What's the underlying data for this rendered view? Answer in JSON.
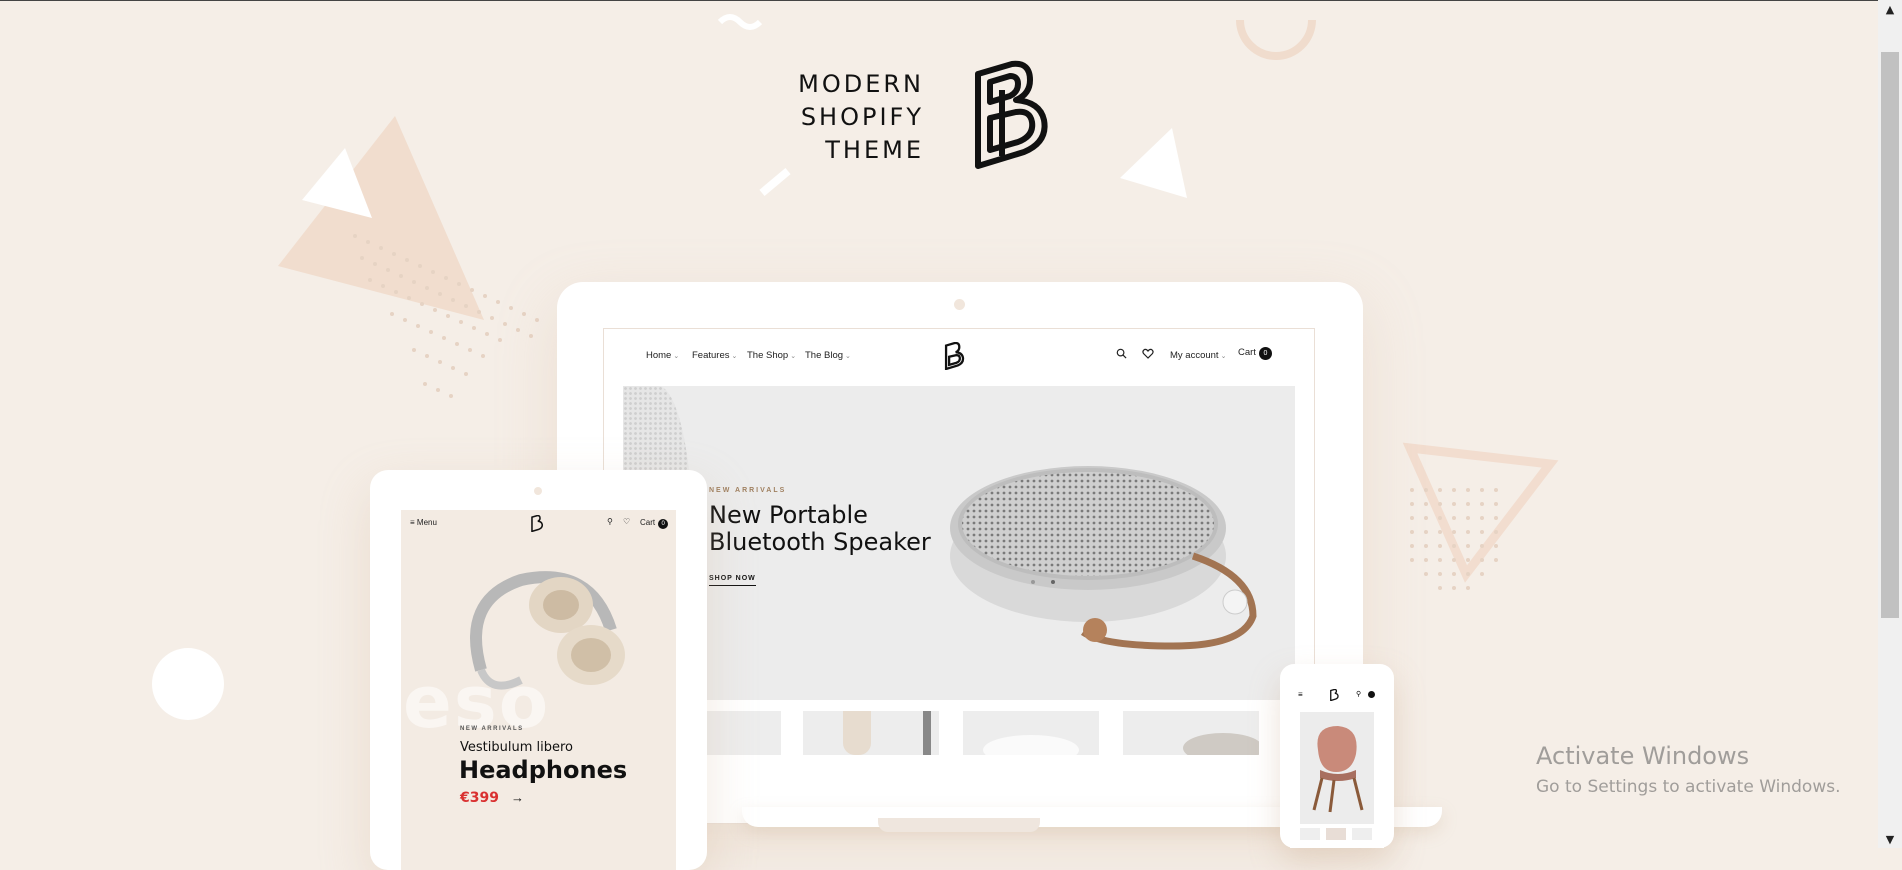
{
  "brand": {
    "line1": "MODERN",
    "line2": "SHOPIFY",
    "line3": "THEME",
    "logo_icon": "b-monogram-logo"
  },
  "laptop_site": {
    "nav": [
      {
        "label": "Home"
      },
      {
        "label": "Features"
      },
      {
        "label": "The Shop"
      },
      {
        "label": "The Blog"
      }
    ],
    "account_label": "My account",
    "cart_label": "Cart",
    "cart_count": "0",
    "hero": {
      "kicker": "NEW ARRIVALS",
      "title_line1": "New Portable",
      "title_line2": "Bluetooth Speaker",
      "cta": "SHOP NOW"
    }
  },
  "tablet_site": {
    "menu_label": "Menu",
    "cart_label": "Cart",
    "cart_count": "0",
    "kicker": "NEW ARRIVALS",
    "subtitle": "Vestibulum libero",
    "title": "Headphones",
    "price": "€399",
    "bg_word": "eso"
  },
  "watermark": {
    "title": "Activate Windows",
    "subtitle": "Go to Settings to activate Windows."
  },
  "colors": {
    "background": "#f5eee7",
    "accent_price": "#d93030",
    "ink": "#111111"
  }
}
